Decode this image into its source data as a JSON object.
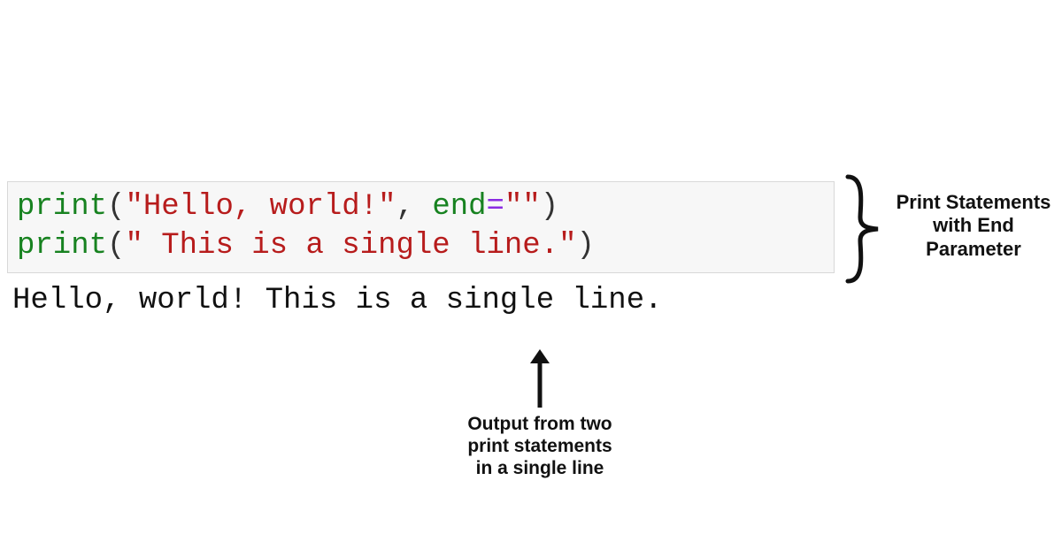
{
  "code": {
    "line1": {
      "func": "print",
      "open": "(",
      "str1": "\"Hello, world!\"",
      "comma_space": ", ",
      "kw": "end",
      "eq": "=",
      "str2": "\"\"",
      "close": ")"
    },
    "line2": {
      "func": "print",
      "open": "(",
      "str": "\" This is a single line.\"",
      "close": ")"
    }
  },
  "output": "Hello, world! This is a single line.",
  "annotations": {
    "brace_label": "Print Statements with End Parameter",
    "arrow_label": "Output from two print statements in a single line"
  },
  "colors": {
    "code_bg": "#f7f7f7",
    "code_border": "#d8d8d8",
    "func": "#178220",
    "string": "#b71c1c",
    "operator": "#8a2be2",
    "punct": "#333333",
    "annotation": "#111111"
  }
}
